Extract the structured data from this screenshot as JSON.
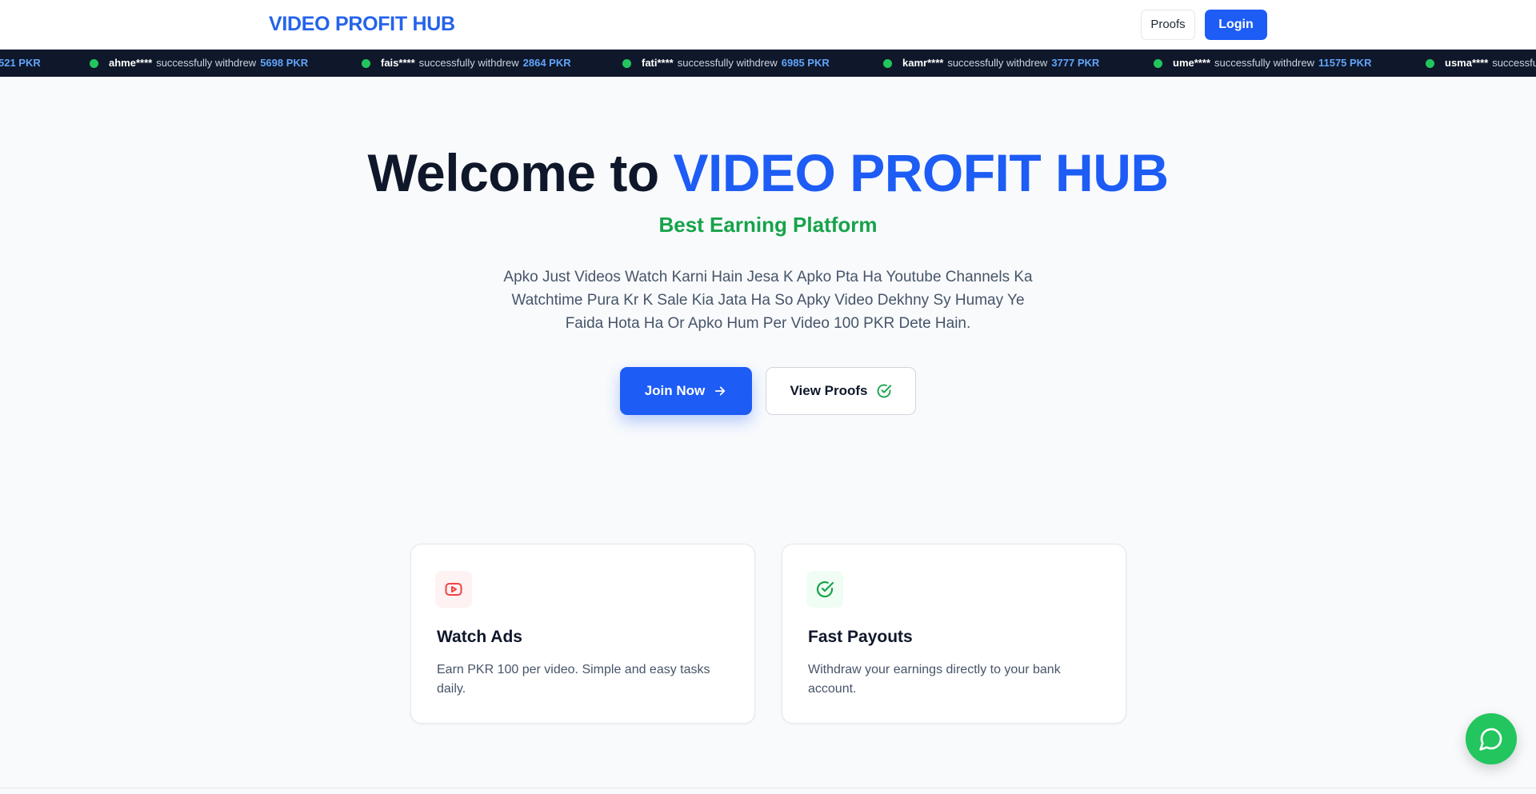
{
  "header": {
    "brand": "VIDEO PROFIT HUB",
    "proofs_label": "Proofs",
    "login_label": "Login"
  },
  "ticker": {
    "message": "successfully withdrew",
    "leading_fragment": "521 PKR",
    "items": [
      {
        "user": "ahme****",
        "amount": "5698 PKR"
      },
      {
        "user": "fais****",
        "amount": "2864 PKR"
      },
      {
        "user": "fati****",
        "amount": "6985 PKR"
      },
      {
        "user": "kamr****",
        "amount": "3777 PKR"
      },
      {
        "user": "ume****",
        "amount": "11575 PKR"
      },
      {
        "user": "usma****",
        "amount": ""
      }
    ],
    "trailing_message": "successfu"
  },
  "hero": {
    "title_prefix": "Welcome to ",
    "title_accent": "VIDEO PROFIT HUB",
    "subtitle": "Best Earning Platform",
    "description": "Apko Just Videos Watch Karni Hain Jesa K Apko Pta Ha Youtube Channels Ka Watchtime Pura Kr K Sale Kia Jata Ha So Apky Video Dekhny Sy Humay Ye Faida Hota Ha Or Apko Hum Per Video 100 PKR Dete Hain.",
    "join_label": "Join Now",
    "proofs_label": "View Proofs"
  },
  "features": [
    {
      "icon": "youtube-play-icon",
      "title": "Watch Ads",
      "description": "Earn PKR 100 per video. Simple and easy tasks daily."
    },
    {
      "icon": "check-circle-icon",
      "title": "Fast Payouts",
      "description": "Withdraw your earnings directly to your bank account."
    }
  ],
  "colors": {
    "primary": "#1d5cf5",
    "success": "#16a34a",
    "ticker_bg": "#0f172a",
    "chat": "#22c55e"
  },
  "chat": {
    "icon": "chat-bubble-icon"
  }
}
